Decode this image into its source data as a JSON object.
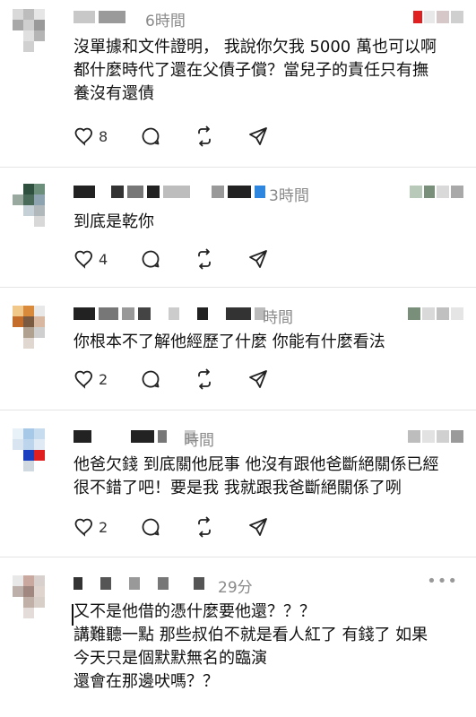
{
  "comments": [
    {
      "time": "6時間",
      "text": "沒單據和文件證明， 我說你欠我 5000 萬也可以啊\n都什麼時代了還在父債子償？當兒子的責任只有撫\n養沒有還債",
      "likes": "8"
    },
    {
      "time": "3時間",
      "text": "到底是乾你",
      "likes": "4"
    },
    {
      "time": "時間",
      "text": "你根本不了解他經歷了什麼 你能有什麼看法",
      "likes": "2"
    },
    {
      "time": "時間",
      "text": "他爸欠錢 到底關他屁事 他沒有跟他爸斷絕關係已經\n很不錯了吧！要是我 我就跟我爸斷絕關係了咧",
      "likes": "2"
    },
    {
      "time": "29分",
      "text": "又不是他借的憑什麼要他還？？？\n講難聽一點 那些叔伯不就是看人紅了 有錢了 如果\n今天只是個默默無名的臨演\n還會在那邊吠嗎？？",
      "likes": ""
    }
  ],
  "icons": {
    "like": "heart-icon",
    "reply": "comment-bubble-icon",
    "repost": "repost-icon",
    "share": "send-icon",
    "more": "more-dots-icon"
  }
}
